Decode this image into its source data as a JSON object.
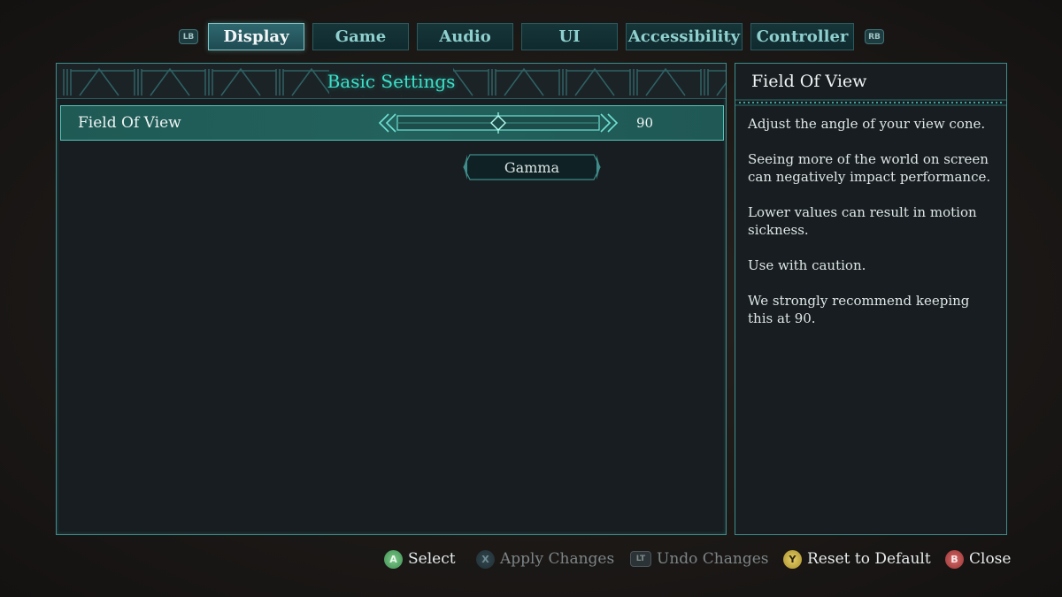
{
  "tabs": {
    "left_bumper": "LB",
    "right_bumper": "RB",
    "items": [
      {
        "label": "Display",
        "active": true
      },
      {
        "label": "Game",
        "active": false
      },
      {
        "label": "Audio",
        "active": false
      },
      {
        "label": "UI",
        "active": false
      },
      {
        "label": "Accessibility",
        "active": false
      },
      {
        "label": "Controller",
        "active": false
      }
    ]
  },
  "main": {
    "section_title": "Basic Settings",
    "settings": [
      {
        "label": "Field Of View",
        "value": "90",
        "slider_fraction": 0.5
      }
    ],
    "gamma_button": "Gamma"
  },
  "info": {
    "title": "Field Of View",
    "paragraphs": [
      "Adjust the angle of your view cone.",
      "Seeing more of the world on screen can negatively impact performance.",
      "Lower values can result in motion sickness.",
      "Use with caution.",
      "We strongly recommend keeping this at 90."
    ]
  },
  "footer": {
    "prompts": [
      {
        "glyph": "A",
        "label": "Select",
        "enabled": true
      },
      {
        "glyph": "X",
        "label": "Apply Changes",
        "enabled": false
      },
      {
        "glyph": "LT",
        "label": "Undo Changes",
        "enabled": false
      },
      {
        "glyph": "Y",
        "label": "Reset to Default",
        "enabled": true
      },
      {
        "glyph": "B",
        "label": "Close",
        "enabled": true
      }
    ]
  },
  "colors": {
    "accent": "#3ee0c9",
    "panel_border": "#3c8e8c",
    "row_highlight": "#23615d",
    "panel_bg": "#171d20"
  }
}
